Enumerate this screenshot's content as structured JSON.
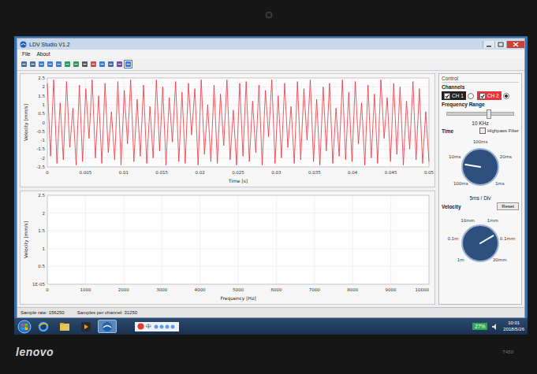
{
  "bezel": {
    "brand": "lenovo",
    "model": "T450"
  },
  "window": {
    "title": "LDV Studio V1.2"
  },
  "menu": [
    "File",
    "About"
  ],
  "time_chart": {
    "y_label": "Velocity [mm/s]",
    "x_label": "Time [s]",
    "y_ticks": [
      "2.5",
      "2",
      "1.5",
      "1",
      "0.5",
      "0",
      "-0.5",
      "-1",
      "-1.5",
      "-2",
      "-2.5"
    ],
    "x_ticks": [
      "0",
      "0.005",
      "0.01",
      "0.015",
      "0.02",
      "0.025",
      "0.03",
      "0.035",
      "0.04",
      "0.045",
      "0.05"
    ],
    "series": [
      {
        "name": "CH 2",
        "color": "#e8323c",
        "values": [
          2.2,
          -1.9,
          2.4,
          -2.3,
          1.1,
          -2.1,
          2.3,
          -1.4,
          0.8,
          -2.4,
          2.1,
          -2.2,
          1.9,
          -0.9,
          2.4,
          -2.0,
          1.5,
          -2.3,
          2.2,
          -1.7,
          0.6,
          -2.1,
          2.3,
          -2.4,
          1.8,
          -1.2,
          2.4,
          -2.2,
          1.3,
          -1.9,
          2.1,
          -2.3,
          0.9,
          -2.0,
          2.4,
          -1.6,
          2.0,
          -2.4,
          1.4,
          -1.1,
          2.3,
          -2.2,
          1.7,
          -2.3,
          2.2,
          -0.7,
          1.9,
          -2.4,
          2.4,
          -1.8,
          1.0,
          -2.2,
          2.1,
          -2.3,
          1.6,
          -1.3,
          2.4,
          -2.1,
          0.7,
          -2.4,
          2.2,
          -1.9,
          2.3,
          -2.2,
          1.2,
          -1.7,
          2.1,
          -2.4,
          1.8,
          -0.8,
          2.4,
          -2.3,
          1.5,
          -2.0,
          2.2,
          -1.4,
          0.9,
          -2.3,
          2.3,
          -2.1,
          1.9,
          -1.0,
          2.4,
          -2.2,
          1.3,
          -2.4,
          2.0,
          -1.6,
          2.2,
          -2.3,
          0.8,
          -1.9,
          2.4,
          -2.1,
          1.7,
          -2.2,
          2.3,
          -1.2,
          1.1,
          -2.4,
          2.1,
          -2.0,
          1.6,
          -2.3,
          2.4,
          -0.9,
          1.4,
          -2.2,
          2.2,
          -1.8,
          2.0,
          -2.4,
          1.2,
          -1.5,
          2.3,
          -2.1,
          1.9,
          -2.3,
          0.6,
          -2.2
        ]
      }
    ]
  },
  "spectrum_chart": {
    "y_label": "Velocity [mm/s]",
    "x_label": "Frequency [Hz]",
    "y_ticks": [
      "2.5",
      "2",
      "1.5",
      "1",
      "0.5",
      "1E-05"
    ],
    "x_ticks": [
      "0",
      "1000",
      "2000",
      "3000",
      "4000",
      "5000",
      "6000",
      "7000",
      "8000",
      "9000",
      "10000"
    ]
  },
  "control": {
    "title": "Control",
    "channels_label": "Channels",
    "channels": [
      {
        "name": "CH 1",
        "checked": true,
        "selected": false,
        "color": "#222222"
      },
      {
        "name": "CH 2",
        "checked": true,
        "selected": true,
        "color": "#e8323c"
      }
    ],
    "frequency": {
      "label": "Frequency Range",
      "level": 0.62,
      "reading": "10 KHz"
    },
    "highpass": {
      "label": "Highpass Filter",
      "checked": false
    },
    "time": {
      "label": "Time",
      "level": 0.2,
      "ticks": [
        "100ms",
        "10ms",
        "100ms",
        "20ms",
        "1ms"
      ],
      "reading": "5ms / Div"
    },
    "velocity": {
      "label": "Velocity",
      "reset": "Reset",
      "level": 0.72,
      "ticks": [
        "1m",
        "0.1m",
        "10mm",
        "1mm",
        "0.1mm",
        "20mm"
      ]
    }
  },
  "status_bar": {
    "sample_rate": "Sample rate: 156250",
    "samples": "Samples per channel: 31250"
  },
  "taskbar": {
    "apps": [
      {
        "kind": "ie",
        "active": false
      },
      {
        "kind": "folder",
        "active": false
      },
      {
        "kind": "media",
        "active": false
      },
      {
        "kind": "ldv",
        "active": true
      }
    ],
    "ime": "中",
    "battery": "27%",
    "time": "10:01",
    "date": "2018/5/26"
  }
}
